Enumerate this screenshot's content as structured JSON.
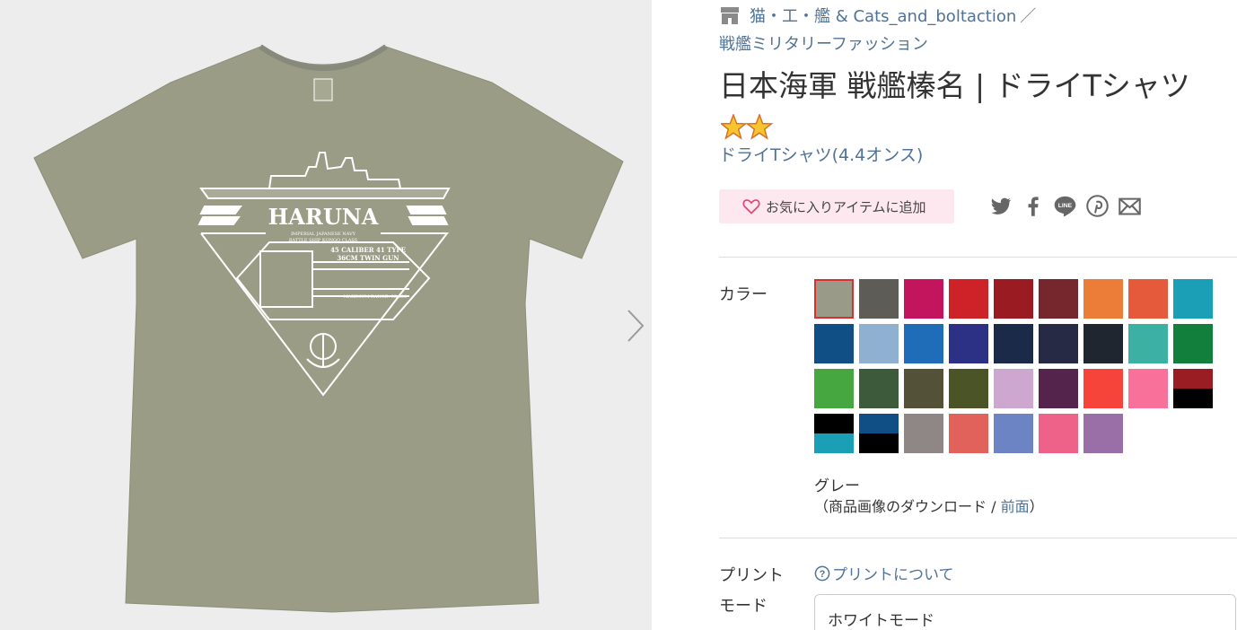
{
  "product_image": {
    "print_text": {
      "ship_name": "HARUNA",
      "sub1": "IMPERIAL JAPANESE NAVY",
      "sub2": "BATTLE SHIP   KONGO CLASS",
      "gun_line1": "45 CALIBER 41 TYPE",
      "gun_line2": "36CM TWIN GUN",
      "range": "MAXIMUM RANGE: 35,000"
    },
    "shirt_color": "#9a9c86",
    "next_icon": "chevron-right-icon"
  },
  "shop": {
    "icon": "shop-icon",
    "name": "猫・工・艦 & Cats_and_boltaction",
    "separator": "／",
    "category": "戦艦ミリタリーファッション"
  },
  "product": {
    "title": "日本海軍 戦艦榛名 | ドライTシャツ",
    "stars_icon": "star-icon",
    "item_type": "ドライTシャツ(4.4オンス)"
  },
  "favorite": {
    "label": "お気に入りアイテムに追加",
    "icon": "heart-icon"
  },
  "share": [
    {
      "name": "twitter-icon"
    },
    {
      "name": "facebook-icon"
    },
    {
      "name": "line-icon"
    },
    {
      "name": "pinterest-icon"
    },
    {
      "name": "mail-icon"
    }
  ],
  "color": {
    "label": "カラー",
    "selected_name": "グレー",
    "download_prefix": "（商品画像のダウンロード / ",
    "download_link": "前面",
    "download_suffix": "）",
    "swatches": [
      {
        "c1": "#9a9a88",
        "selected": true
      },
      {
        "c1": "#5e5c56"
      },
      {
        "c1": "#c2155e"
      },
      {
        "c1": "#cc2228"
      },
      {
        "c1": "#9a1b22"
      },
      {
        "c1": "#76272e"
      },
      {
        "c1": "#ec7d38"
      },
      {
        "c1": "#e55a3a"
      },
      {
        "c1": "#1a9fb7"
      },
      {
        "c1": "#0f4f86"
      },
      {
        "c1": "#8fb0d0"
      },
      {
        "c1": "#1f6db8"
      },
      {
        "c1": "#2c3185"
      },
      {
        "c1": "#1b2a48"
      },
      {
        "c1": "#262a44"
      },
      {
        "c1": "#1f2630"
      },
      {
        "c1": "#3cb1a3"
      },
      {
        "c1": "#137f3c"
      },
      {
        "c1": "#46a63f"
      },
      {
        "c1": "#3d5a3b"
      },
      {
        "c1": "#535137"
      },
      {
        "c1": "#4a5426"
      },
      {
        "c1": "#cda7cf"
      },
      {
        "c1": "#54244c"
      },
      {
        "c1": "#f6443b"
      },
      {
        "c1": "#f7719b"
      },
      {
        "c1": "#9a1d24",
        "c2": "#000000"
      },
      {
        "c1": "#000000",
        "c2": "#1a9fb7"
      },
      {
        "c1": "#0f4f86",
        "c2": "#000000"
      },
      {
        "c1": "#8e8785"
      },
      {
        "c1": "#e0625a"
      },
      {
        "c1": "#6c84c3"
      },
      {
        "c1": "#ee6188"
      },
      {
        "c1": "#9a6fa8"
      }
    ]
  },
  "print": {
    "label": "プリント",
    "about_link": "プリントについて",
    "about_icon": "question-circle-icon",
    "mode_label": "モード",
    "mode_value": "ホワイトモード"
  },
  "colors": {
    "link": "#4f7397",
    "fav_bg": "#fce8ee",
    "heart": "#e14a7a",
    "selected_outline": "#d9302f"
  }
}
